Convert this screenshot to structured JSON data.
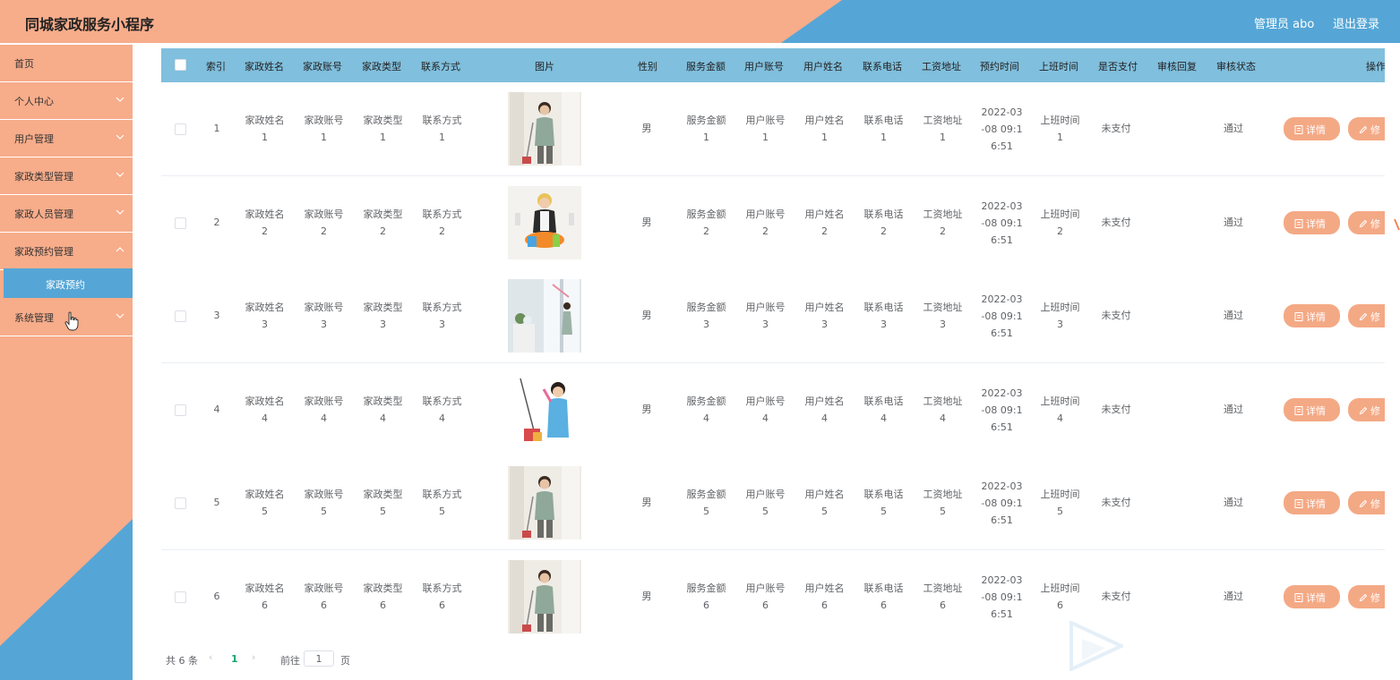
{
  "header": {
    "title": "同城家政服务小程序",
    "admin_label": "管理员 abo",
    "logout_label": "退出登录"
  },
  "sidebar": {
    "items": [
      {
        "label": "首页"
      },
      {
        "label": "个人中心"
      },
      {
        "label": "用户管理"
      },
      {
        "label": "家政类型管理"
      },
      {
        "label": "家政人员管理"
      },
      {
        "label": "家政预约管理"
      },
      {
        "label": "系统管理"
      }
    ],
    "submenu": {
      "label": "家政预约"
    }
  },
  "table": {
    "columns": [
      "索引",
      "家政姓名",
      "家政账号",
      "家政类型",
      "联系方式",
      "图片",
      "性别",
      "服务金额",
      "用户账号",
      "用户姓名",
      "联系电话",
      "工资地址",
      "预约时间",
      "上班时间",
      "是否支付",
      "审核回复",
      "审核状态",
      "操作"
    ],
    "rows": [
      {
        "index": "1",
        "name": [
          "家政姓名",
          "1"
        ],
        "account": [
          "家政账号",
          "1"
        ],
        "type": [
          "家政类型",
          "1"
        ],
        "contact": [
          "联系方式",
          "1"
        ],
        "gender": "男",
        "amount": [
          "服务金额",
          "1"
        ],
        "user_account": [
          "用户账号",
          "1"
        ],
        "user_name": [
          "用户姓名",
          "1"
        ],
        "phone": [
          "联系电话",
          "1"
        ],
        "address": [
          "工资地址",
          "1"
        ],
        "time": [
          "2022-03",
          "-08 09:1",
          "6:51"
        ],
        "work_time": [
          "上班时间",
          "1"
        ],
        "paid": "未支付",
        "reply": "",
        "status": "通过"
      },
      {
        "index": "2",
        "name": [
          "家政姓名",
          "2"
        ],
        "account": [
          "家政账号",
          "2"
        ],
        "type": [
          "家政类型",
          "2"
        ],
        "contact": [
          "联系方式",
          "2"
        ],
        "gender": "男",
        "amount": [
          "服务金额",
          "2"
        ],
        "user_account": [
          "用户账号",
          "2"
        ],
        "user_name": [
          "用户姓名",
          "2"
        ],
        "phone": [
          "联系电话",
          "2"
        ],
        "address": [
          "工资地址",
          "2"
        ],
        "time": [
          "2022-03",
          "-08 09:1",
          "6:51"
        ],
        "work_time": [
          "上班时间",
          "2"
        ],
        "paid": "未支付",
        "reply": "",
        "status": "通过"
      },
      {
        "index": "3",
        "name": [
          "家政姓名",
          "3"
        ],
        "account": [
          "家政账号",
          "3"
        ],
        "type": [
          "家政类型",
          "3"
        ],
        "contact": [
          "联系方式",
          "3"
        ],
        "gender": "男",
        "amount": [
          "服务金额",
          "3"
        ],
        "user_account": [
          "用户账号",
          "3"
        ],
        "user_name": [
          "用户姓名",
          "3"
        ],
        "phone": [
          "联系电话",
          "3"
        ],
        "address": [
          "工资地址",
          "3"
        ],
        "time": [
          "2022-03",
          "-08 09:1",
          "6:51"
        ],
        "work_time": [
          "上班时间",
          "3"
        ],
        "paid": "未支付",
        "reply": "",
        "status": "通过"
      },
      {
        "index": "4",
        "name": [
          "家政姓名",
          "4"
        ],
        "account": [
          "家政账号",
          "4"
        ],
        "type": [
          "家政类型",
          "4"
        ],
        "contact": [
          "联系方式",
          "4"
        ],
        "gender": "男",
        "amount": [
          "服务金额",
          "4"
        ],
        "user_account": [
          "用户账号",
          "4"
        ],
        "user_name": [
          "用户姓名",
          "4"
        ],
        "phone": [
          "联系电话",
          "4"
        ],
        "address": [
          "工资地址",
          "4"
        ],
        "time": [
          "2022-03",
          "-08 09:1",
          "6:51"
        ],
        "work_time": [
          "上班时间",
          "4"
        ],
        "paid": "未支付",
        "reply": "",
        "status": "通过"
      },
      {
        "index": "5",
        "name": [
          "家政姓名",
          "5"
        ],
        "account": [
          "家政账号",
          "5"
        ],
        "type": [
          "家政类型",
          "5"
        ],
        "contact": [
          "联系方式",
          "5"
        ],
        "gender": "男",
        "amount": [
          "服务金额",
          "5"
        ],
        "user_account": [
          "用户账号",
          "5"
        ],
        "user_name": [
          "用户姓名",
          "5"
        ],
        "phone": [
          "联系电话",
          "5"
        ],
        "address": [
          "工资地址",
          "5"
        ],
        "time": [
          "2022-03",
          "-08 09:1",
          "6:51"
        ],
        "work_time": [
          "上班时间",
          "5"
        ],
        "paid": "未支付",
        "reply": "",
        "status": "通过"
      },
      {
        "index": "6",
        "name": [
          "家政姓名",
          "6"
        ],
        "account": [
          "家政账号",
          "6"
        ],
        "type": [
          "家政类型",
          "6"
        ],
        "contact": [
          "联系方式",
          "6"
        ],
        "gender": "男",
        "amount": [
          "服务金额",
          "6"
        ],
        "user_account": [
          "用户账号",
          "6"
        ],
        "user_name": [
          "用户姓名",
          "6"
        ],
        "phone": [
          "联系电话",
          "6"
        ],
        "address": [
          "工资地址",
          "6"
        ],
        "time": [
          "2022-03",
          "-08 09:1",
          "6:51"
        ],
        "work_time": [
          "上班时间",
          "6"
        ],
        "paid": "未支付",
        "reply": "",
        "status": "通过"
      }
    ],
    "actions": {
      "detail": "详情",
      "edit": "修"
    }
  },
  "pagination": {
    "total": "共 6 条",
    "prev": "‹",
    "current": "1",
    "next": "›",
    "goto_label": "前往",
    "goto_value": "1",
    "page_suffix": "页"
  },
  "colors": {
    "accent_orange": "#f7ac8a",
    "accent_blue": "#55a6d6",
    "table_header": "#80bfdd",
    "button": "#f4a985",
    "pagination_active": "#1aa36a"
  },
  "icons": {
    "menu_arrow": "chevron-down-icon",
    "detail": "document-icon",
    "edit": "pencil-icon",
    "cursor": "hand-pointer-icon"
  }
}
